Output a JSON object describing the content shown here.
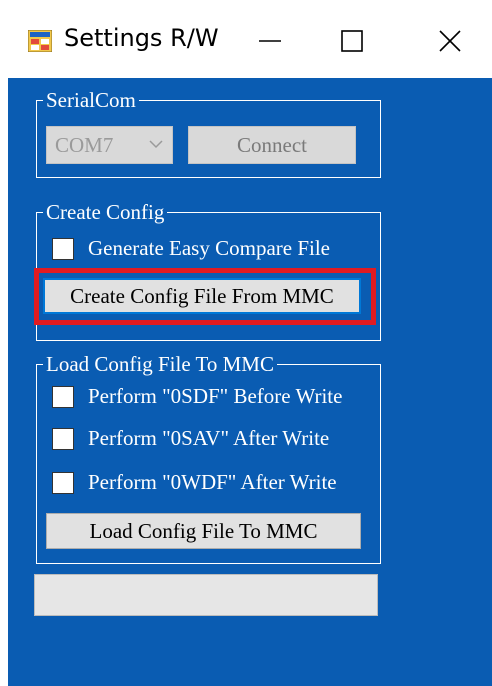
{
  "window": {
    "title": "Settings R/W",
    "icon": "app-window-icon",
    "controls": {
      "minimize_icon": "minimize-icon",
      "maximize_icon": "maximize-icon",
      "close_icon": "close-icon"
    }
  },
  "colors": {
    "client_background": "#0a5cb2",
    "highlight_border": "#e11b22"
  },
  "serial": {
    "group_label": "SerialCom",
    "port_value": "COM7",
    "connect_label": "Connect"
  },
  "create_config": {
    "group_label": "Create Config",
    "easy_compare_label": "Generate Easy Compare File",
    "easy_compare_checked": false,
    "create_button_label": "Create Config File From MMC"
  },
  "load_config": {
    "group_label": "Load Config File To MMC",
    "options": [
      {
        "label": "Perform \"0SDF\" Before Write",
        "checked": false
      },
      {
        "label": "Perform \"0SAV\" After Write",
        "checked": false
      },
      {
        "label": "Perform \"0WDF\" After Write",
        "checked": false
      }
    ],
    "load_button_label": "Load Config File To MMC"
  },
  "progress": {
    "value": 0
  }
}
